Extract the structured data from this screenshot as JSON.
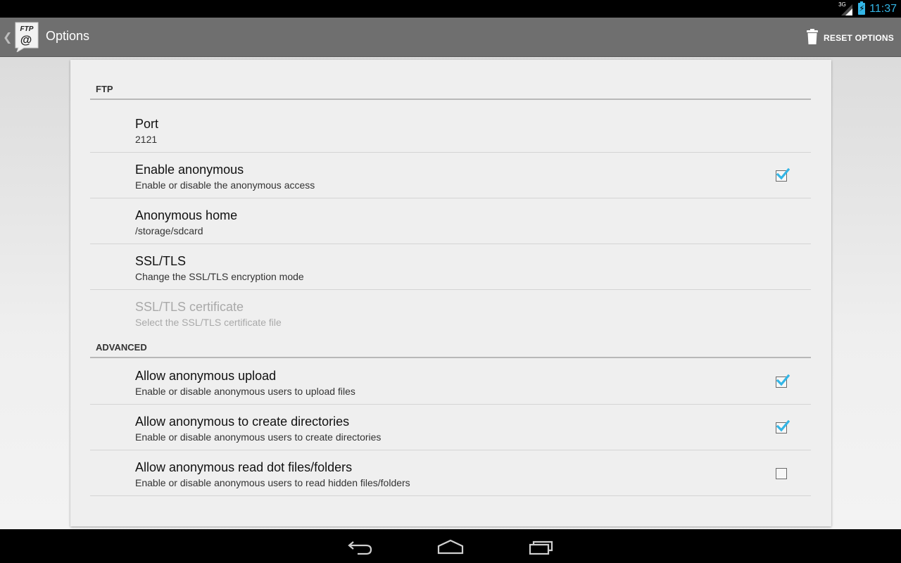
{
  "status_bar": {
    "time": "11:37",
    "network_tag": "3G",
    "icons": [
      "signal-icon",
      "battery-charging-icon"
    ],
    "accent_color": "#33b5e5"
  },
  "action_bar": {
    "app_icon_text": "FTP",
    "app_icon_symbol": "@",
    "title": "Options",
    "reset_label": "RESET OPTIONS",
    "reset_icon": "trash-icon"
  },
  "sections": {
    "ftp": {
      "header": "FTP",
      "prefs": [
        {
          "title": "Port",
          "summary": "2121"
        },
        {
          "title": "Enable anonymous",
          "summary": "Enable or disable the anonymous access",
          "checked": true
        },
        {
          "title": "Anonymous home",
          "summary": "/storage/sdcard"
        },
        {
          "title": "SSL/TLS",
          "summary": "Change the SSL/TLS encryption mode"
        },
        {
          "title": "SSL/TLS certificate",
          "summary": "Select the SSL/TLS certificate file",
          "enabled": false
        }
      ]
    },
    "advanced": {
      "header": "ADVANCED",
      "prefs": [
        {
          "title": "Allow anonymous upload",
          "summary": "Enable or disable anonymous users to upload files",
          "checked": true
        },
        {
          "title": "Allow anonymous to create directories",
          "summary": "Enable or disable anonymous users to create directories",
          "checked": true
        },
        {
          "title": "Allow anonymous read dot files/folders",
          "summary": "Enable or disable anonymous users to read hidden files/folders",
          "checked": false
        }
      ]
    }
  },
  "nav_bar": {
    "icons": [
      "back-icon",
      "home-icon",
      "recent-apps-icon"
    ]
  }
}
